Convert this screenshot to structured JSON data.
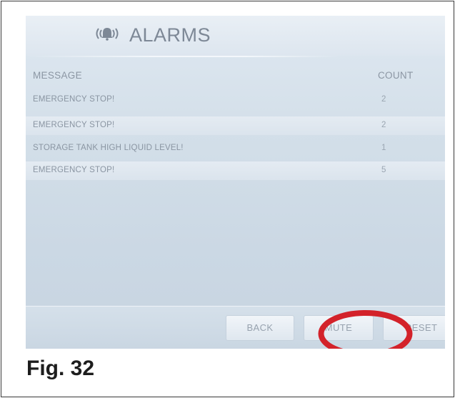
{
  "screen": {
    "title": "ALARMS",
    "title_icon": "alarm-bell-icon"
  },
  "table": {
    "columns": {
      "message": "MESSAGE",
      "count": "COUNT"
    },
    "rows": [
      {
        "message": "EMERGENCY STOP!",
        "count": "2"
      },
      {
        "message": "EMERGENCY STOP!",
        "count": "2"
      },
      {
        "message": "STORAGE TANK HIGH LIQUID LEVEL!",
        "count": "1"
      },
      {
        "message": "EMERGENCY STOP!",
        "count": "5"
      }
    ]
  },
  "footer": {
    "back_label": "BACK",
    "mute_label": "MUTE",
    "reset_label": "RESET"
  },
  "annotation": {
    "highlight_color": "#d3222a",
    "highlighted_control": "mute-button"
  },
  "figure": {
    "caption": "Fig. 32"
  },
  "colors": {
    "screen_bg": "#d3dfe9",
    "text": "#8a95a2"
  }
}
